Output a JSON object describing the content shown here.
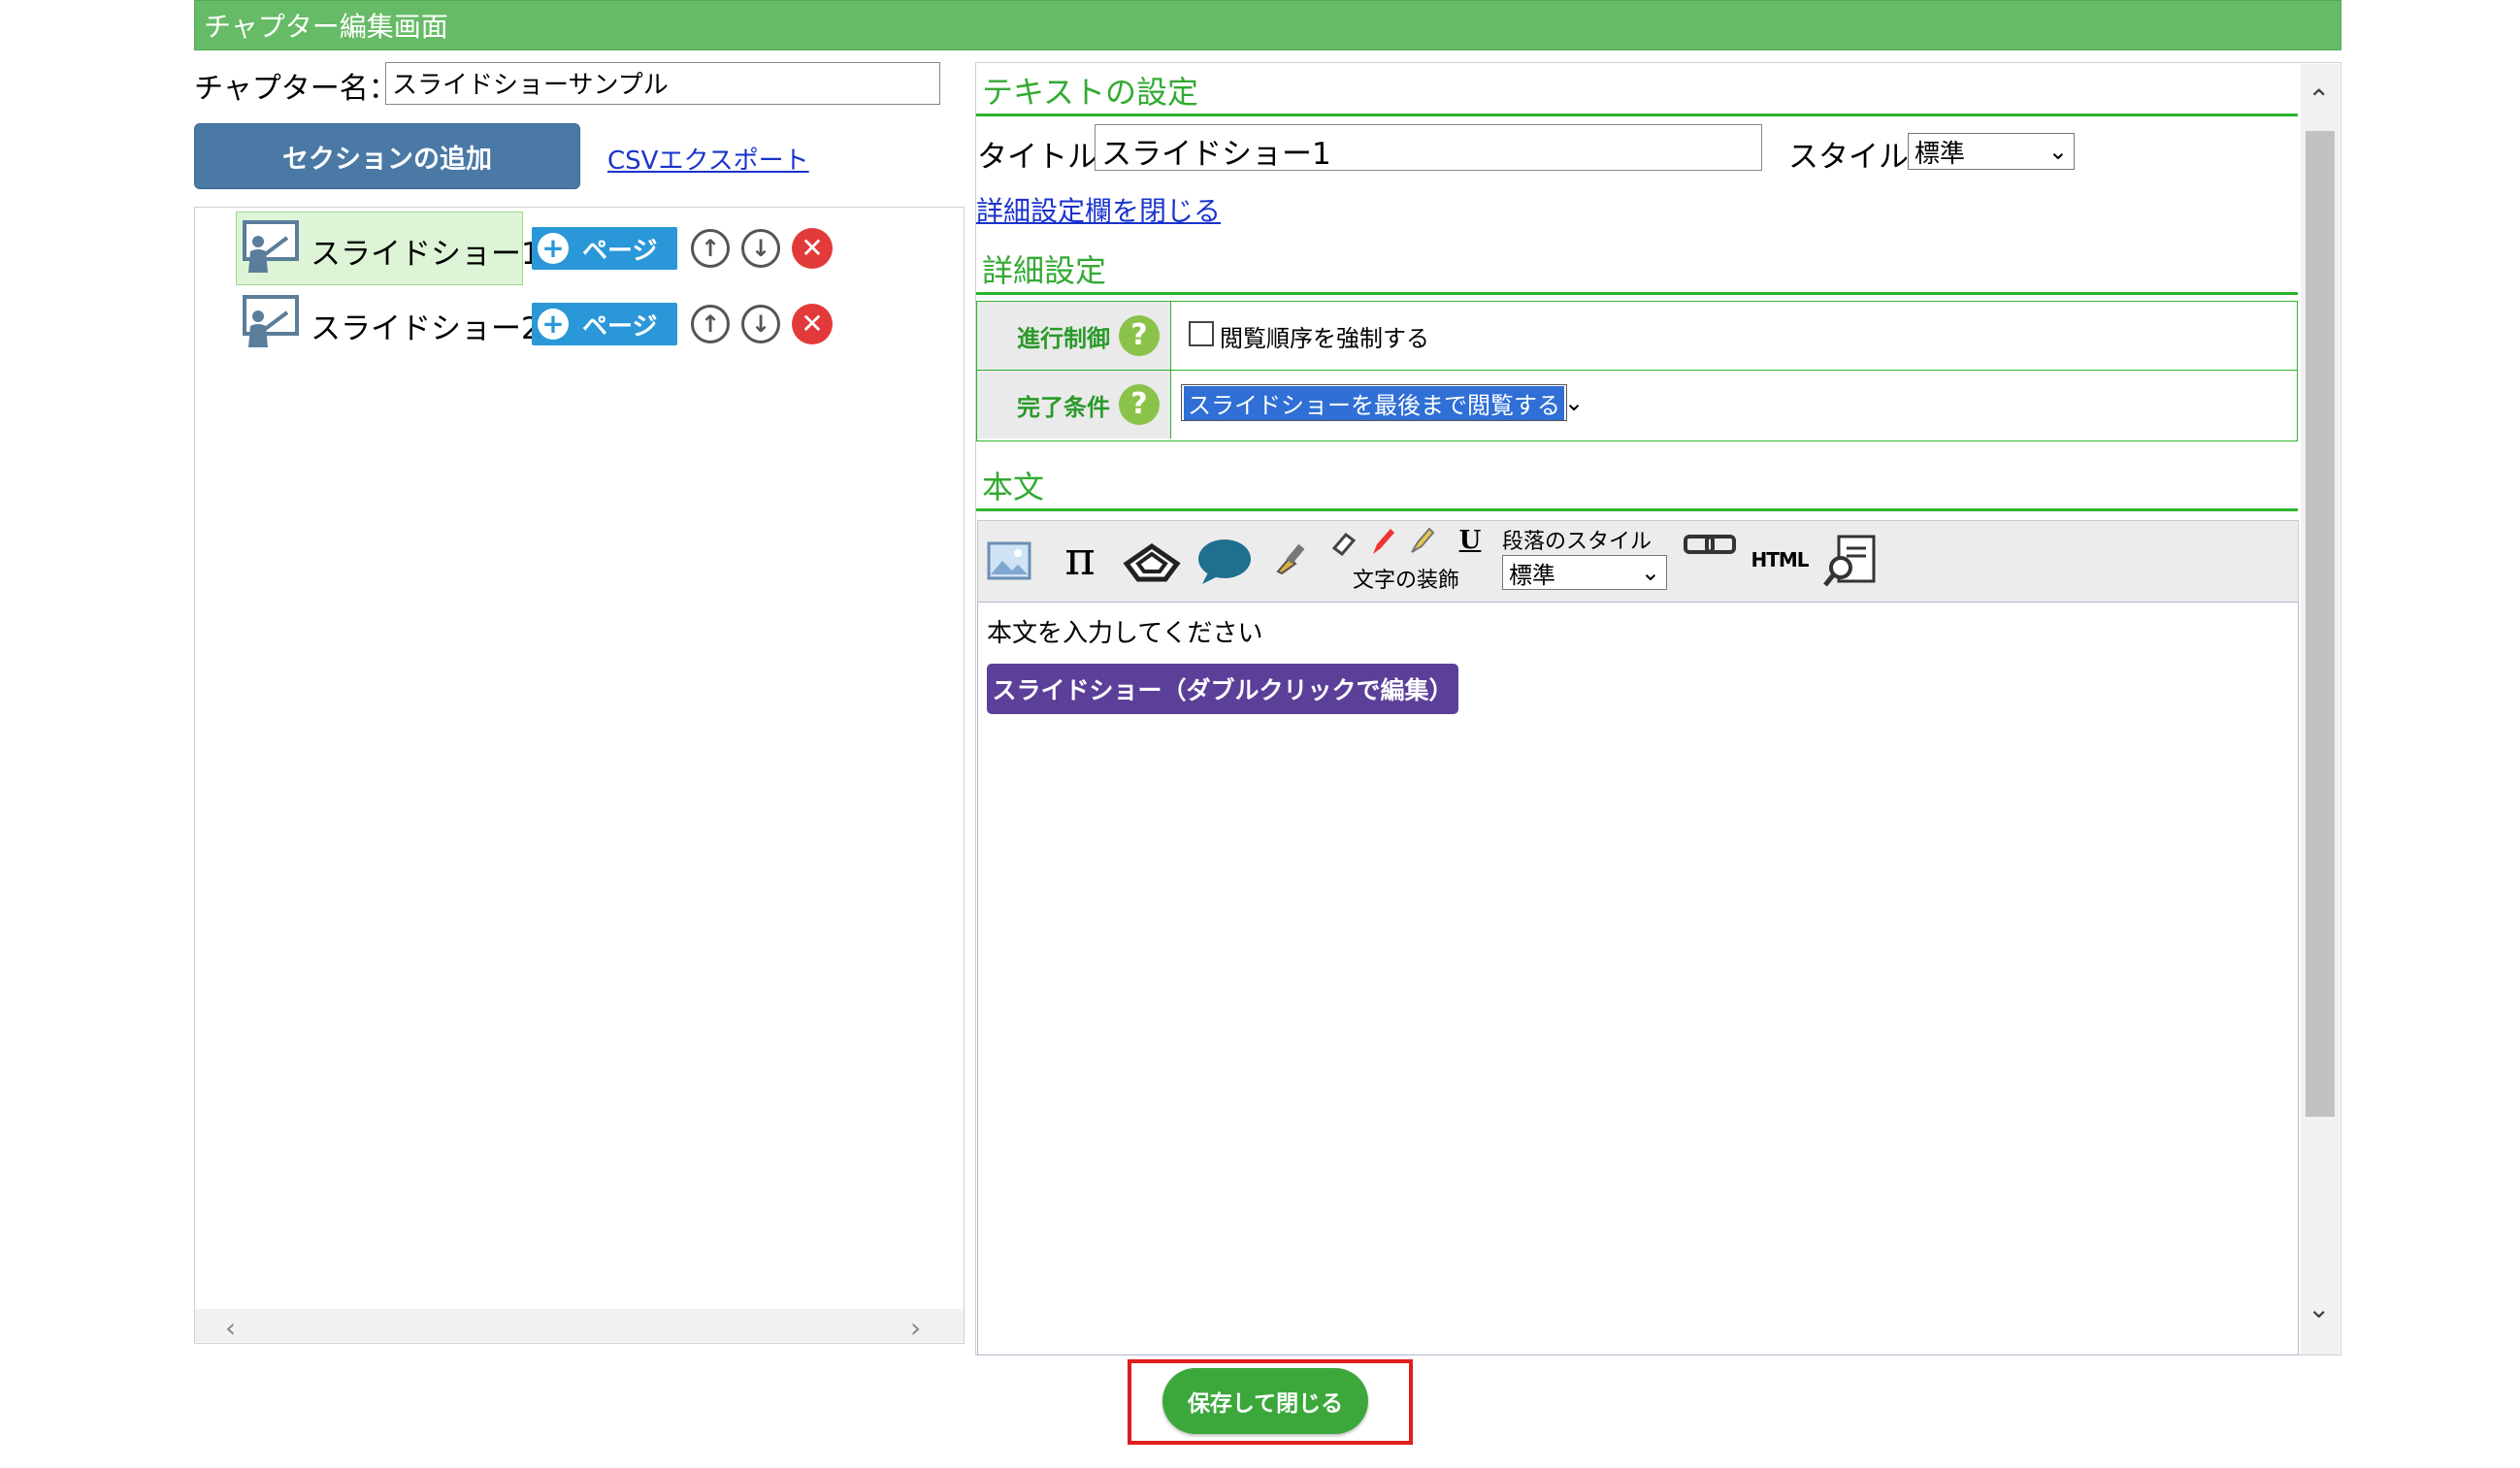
{
  "header": {
    "title": "チャプター編集画面"
  },
  "left": {
    "chapter_label": "チャプター名：",
    "chapter_value": "スライドショーサンプル",
    "add_section_label": "セクションの追加",
    "csv_export_label": "CSVエクスポート",
    "sections": [
      {
        "label": "スライドショー1",
        "page_label": "ページ"
      },
      {
        "label": "スライドショー2",
        "page_label": "ページ"
      }
    ]
  },
  "right": {
    "text_settings_heading": "テキストの設定",
    "title_label": "タイトル:",
    "title_value": "スライドショー1",
    "style_label": "スタイル:",
    "style_value": "標準",
    "close_detail_link": "詳細設定欄を閉じる",
    "detail_heading": "詳細設定",
    "detail": {
      "progress_label": "進行制御",
      "progress_checkbox_label": "閲覧順序を強制する",
      "completion_label": "完了条件",
      "completion_value": "スライドショーを最後まで閲覧する"
    },
    "body_heading": "本文",
    "toolbar": {
      "pi_glyph": "π",
      "underline_glyph": "U",
      "char_decoration_label": "文字の装飾",
      "paragraph_style_label": "段落のスタイル",
      "paragraph_style_value": "標準",
      "html_label": "HTML"
    },
    "editor": {
      "text": "本文を入力してください",
      "slideshow_badge": "スライドショー（ダブルクリックで編集）"
    }
  },
  "footer": {
    "save_close_label": "保存して閉じる"
  },
  "colors": {
    "header_green": "#66bb66",
    "accent_blue": "#2a97d8",
    "badge_purple": "#5b3f99",
    "save_green": "#3ca83c",
    "highlight_red": "#e11d1d"
  }
}
